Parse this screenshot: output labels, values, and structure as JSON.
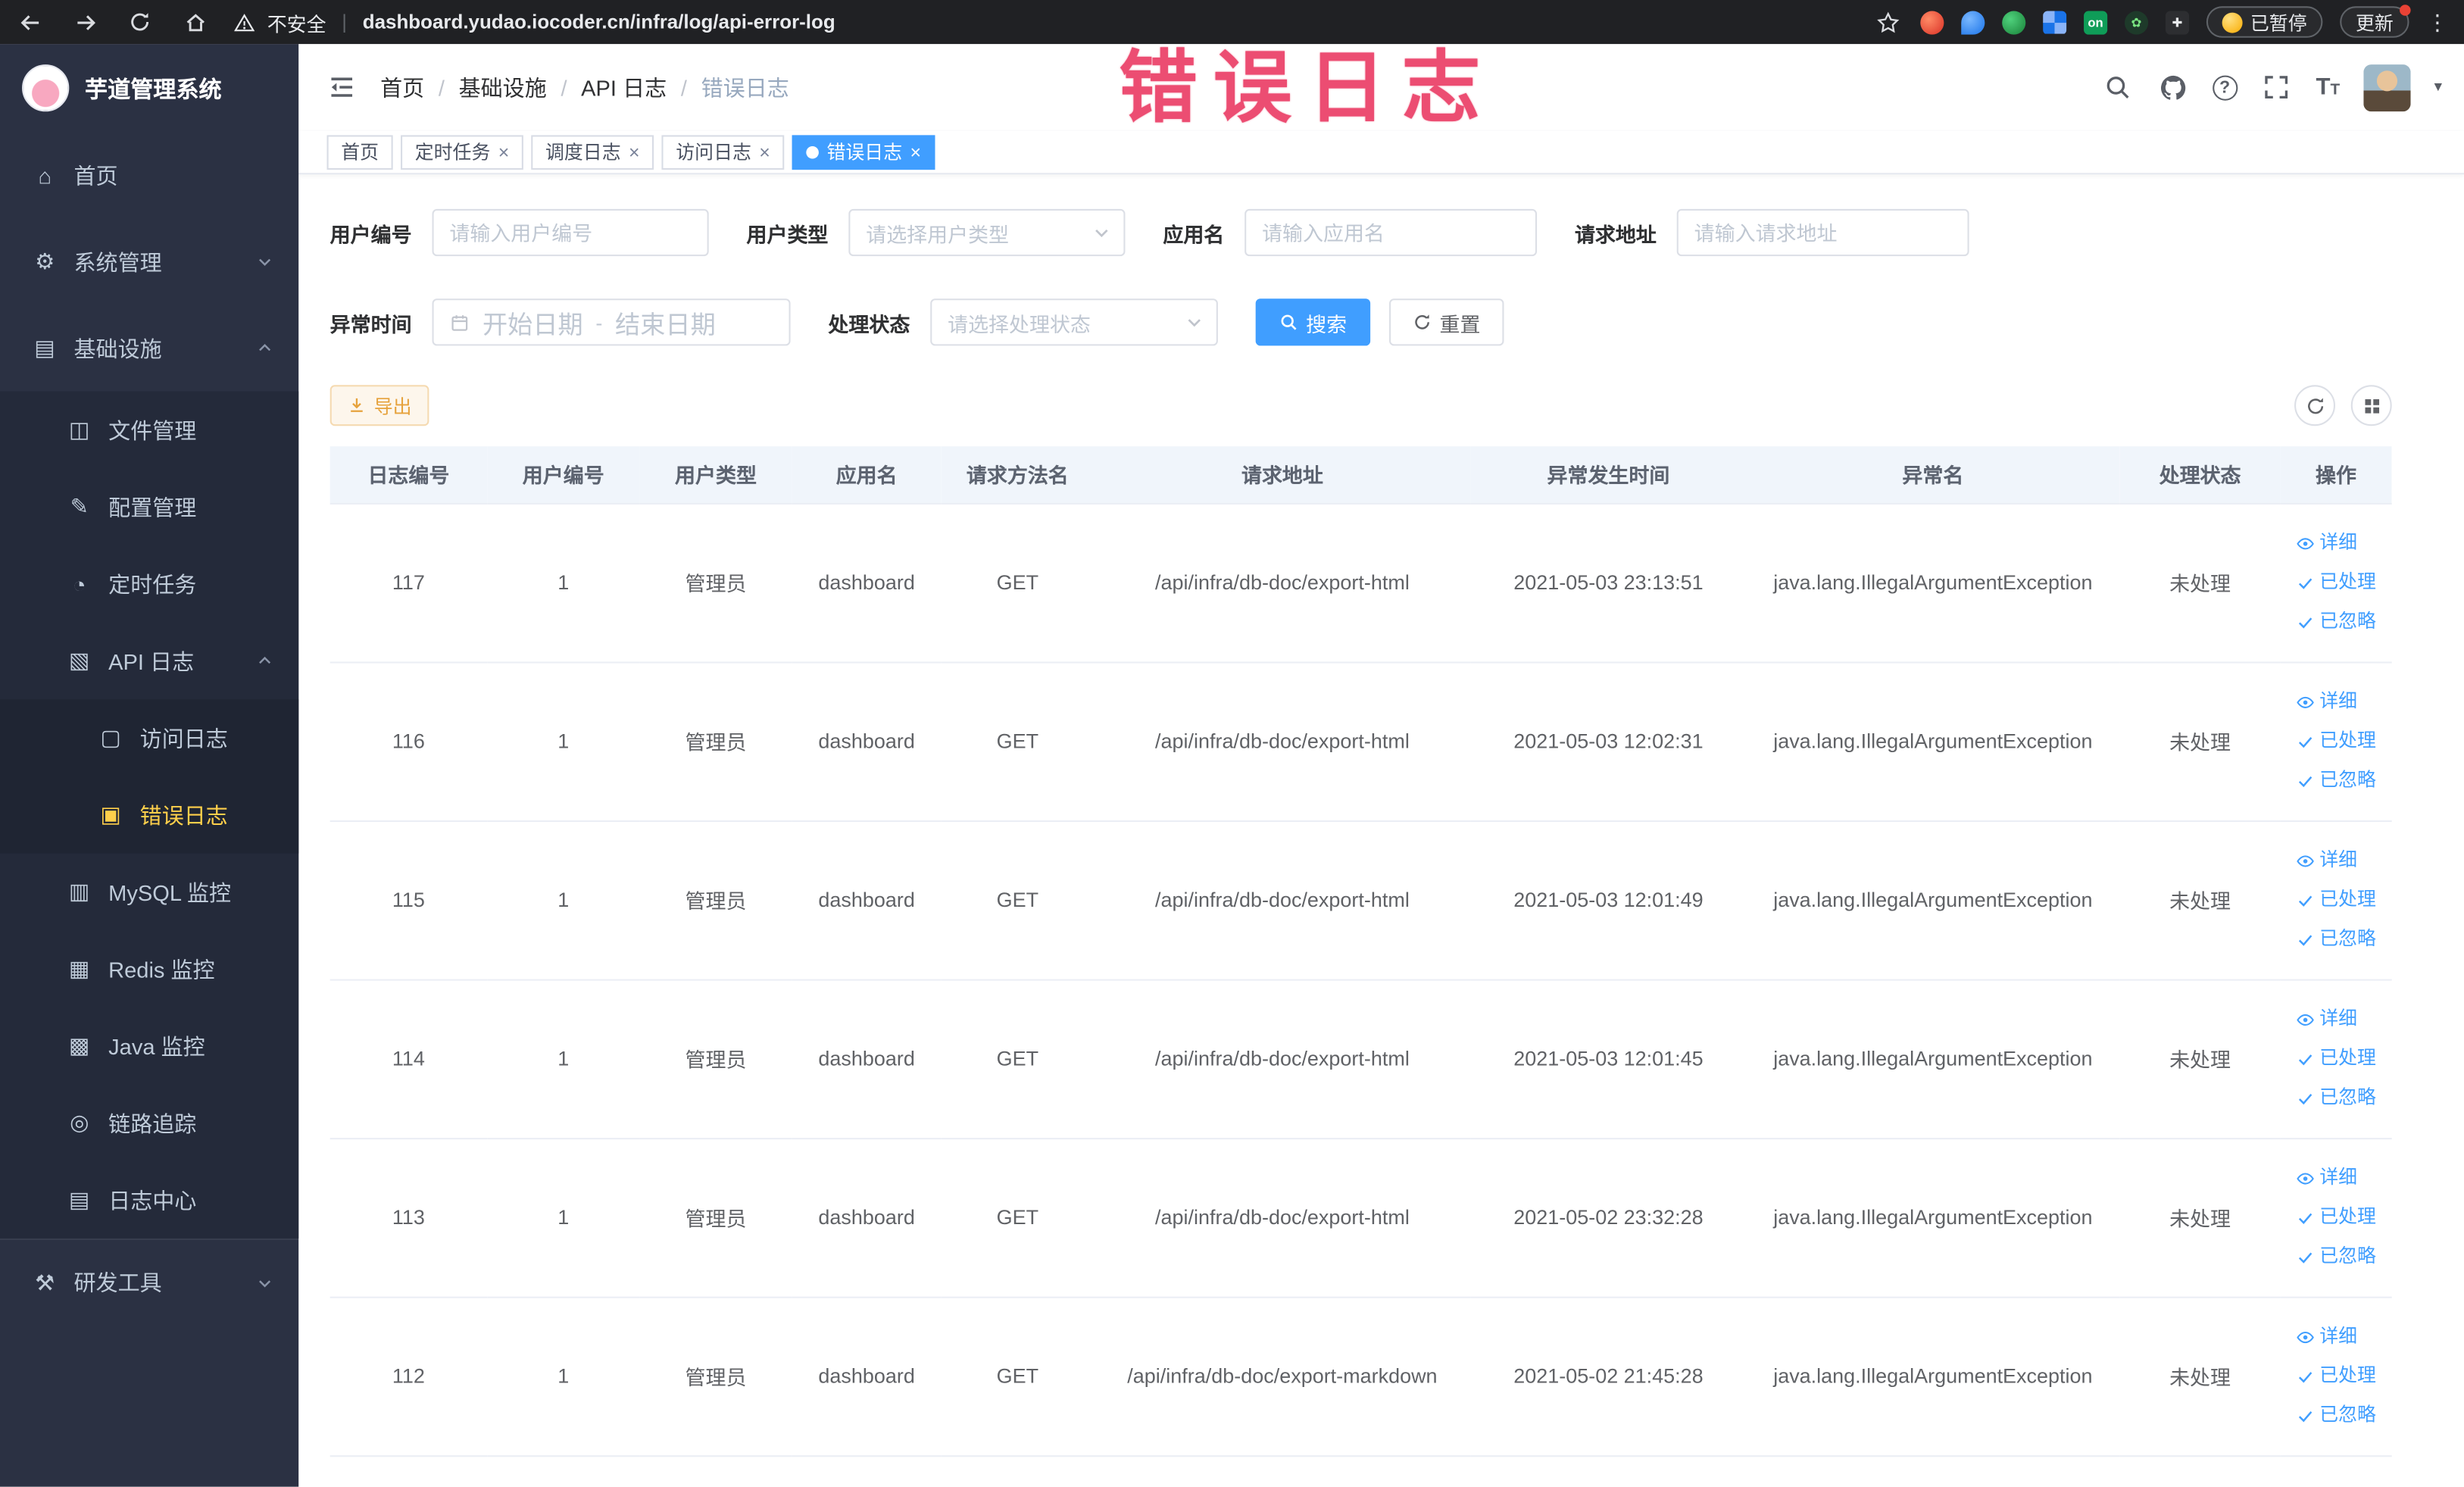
{
  "colors": {
    "accent": "#409eff",
    "sidebar_bg": "#2b3143",
    "sidebar_active_text": "#ffd04b",
    "watermark": "#ec4d72",
    "warning_button_text": "#e6a23c",
    "table_header_bg": "#f0f5fb"
  },
  "watermark_text": "错误日志",
  "symbols": {
    "close": "×",
    "more": "⋮",
    "caret": "▾",
    "help": "?",
    "font_size_big": "T",
    "font_size_small": "T",
    "url_separator": "|"
  },
  "browser": {
    "security_label": "不安全",
    "url": "dashboard.yudao.iocoder.cn/infra/log/api-error-log",
    "extension_on_badge": "on",
    "paused_badge": "已暂停",
    "update_button": "更新"
  },
  "sidebar": {
    "app_title": "芋道管理系统",
    "icons": {
      "home": "⌂",
      "system": "⚙",
      "infra": "▤",
      "file": "◫",
      "config": "✎",
      "job": "◔",
      "api_log": "▧",
      "access_log": "▢",
      "error_log": "▣",
      "mysql": "▥",
      "redis": "▦",
      "java": "▩",
      "trace": "◎",
      "log_center": "▤",
      "dev_tools": "⚒"
    },
    "items": {
      "home": "首页",
      "system": "系统管理",
      "infra": "基础设施",
      "file": "文件管理",
      "config": "配置管理",
      "job": "定时任务",
      "api_log": "API 日志",
      "access_log": "访问日志",
      "error_log": "错误日志",
      "mysql": "MySQL 监控",
      "redis": "Redis 监控",
      "java": "Java 监控",
      "trace": "链路追踪",
      "log_center": "日志中心",
      "dev_tools": "研发工具"
    }
  },
  "breadcrumb": {
    "separator": "/",
    "items": [
      "首页",
      "基础设施",
      "API 日志",
      "错误日志"
    ]
  },
  "tags": [
    {
      "label": "首页"
    },
    {
      "label": "定时任务"
    },
    {
      "label": "调度日志"
    },
    {
      "label": "访问日志"
    },
    {
      "label": "错误日志"
    }
  ],
  "filters": {
    "user_id_label": "用户编号",
    "user_id_placeholder": "请输入用户编号",
    "user_type_label": "用户类型",
    "user_type_placeholder": "请选择用户类型",
    "app_name_label": "应用名",
    "app_name_placeholder": "请输入应用名",
    "request_url_label": "请求地址",
    "request_url_placeholder": "请输入请求地址",
    "exception_time_label": "异常时间",
    "start_date_placeholder": "开始日期",
    "end_date_placeholder": "结束日期",
    "range_separator": "-",
    "process_status_label": "处理状态",
    "process_status_placeholder": "请选择处理状态",
    "search_button": "搜索",
    "reset_button": "重置"
  },
  "toolbar": {
    "export_button": "导出"
  },
  "table": {
    "headers": [
      "日志编号",
      "用户编号",
      "用户类型",
      "应用名",
      "请求方法名",
      "请求地址",
      "异常发生时间",
      "异常名",
      "处理状态",
      "操作"
    ],
    "actions": [
      "详细",
      "已处理",
      "已忽略"
    ],
    "rows": [
      {
        "id": "117",
        "user_id": "1",
        "user_type": "管理员",
        "app": "dashboard",
        "method": "GET",
        "url": "/api/infra/db-doc/export-html",
        "time": "2021-05-03 23:13:51",
        "exception": "java.lang.IllegalArgumentException",
        "status": "未处理"
      },
      {
        "id": "116",
        "user_id": "1",
        "user_type": "管理员",
        "app": "dashboard",
        "method": "GET",
        "url": "/api/infra/db-doc/export-html",
        "time": "2021-05-03 12:02:31",
        "exception": "java.lang.IllegalArgumentException",
        "status": "未处理"
      },
      {
        "id": "115",
        "user_id": "1",
        "user_type": "管理员",
        "app": "dashboard",
        "method": "GET",
        "url": "/api/infra/db-doc/export-html",
        "time": "2021-05-03 12:01:49",
        "exception": "java.lang.IllegalArgumentException",
        "status": "未处理"
      },
      {
        "id": "114",
        "user_id": "1",
        "user_type": "管理员",
        "app": "dashboard",
        "method": "GET",
        "url": "/api/infra/db-doc/export-html",
        "time": "2021-05-03 12:01:45",
        "exception": "java.lang.IllegalArgumentException",
        "status": "未处理"
      },
      {
        "id": "113",
        "user_id": "1",
        "user_type": "管理员",
        "app": "dashboard",
        "method": "GET",
        "url": "/api/infra/db-doc/export-html",
        "time": "2021-05-02 23:32:28",
        "exception": "java.lang.IllegalArgumentException",
        "status": "未处理"
      },
      {
        "id": "112",
        "user_id": "1",
        "user_type": "管理员",
        "app": "dashboard",
        "method": "GET",
        "url": "/api/infra/db-doc/export-markdown",
        "time": "2021-05-02 21:45:28",
        "exception": "java.lang.IllegalArgumentException",
        "status": "未处理"
      }
    ]
  }
}
